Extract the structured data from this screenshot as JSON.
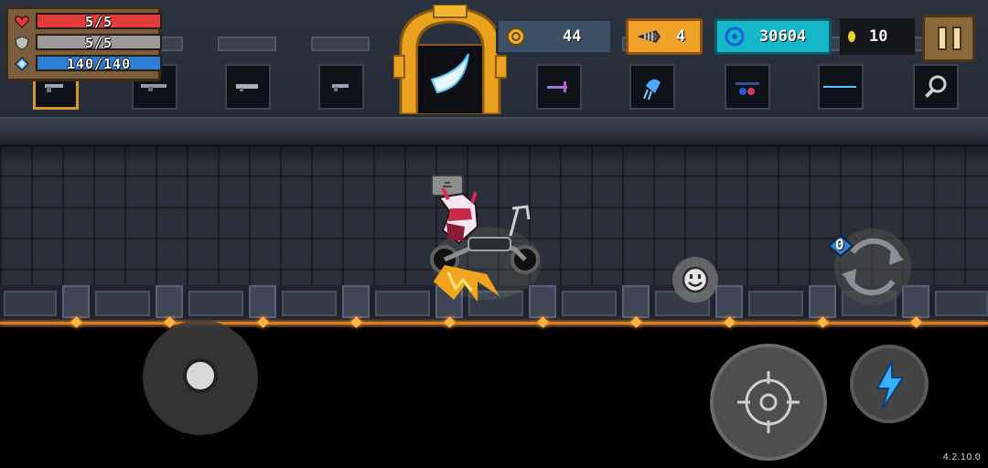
{
  "hud": {
    "health": {
      "text": "5/5",
      "fraction": 1.0,
      "color": "#e03c3c"
    },
    "armor": {
      "text": "5/5",
      "fraction": 1.0,
      "color": "#9a9a9a"
    },
    "energy": {
      "text": "140/140",
      "fraction": 1.0,
      "color": "#2d7fd6"
    }
  },
  "currency": {
    "coins": "44",
    "materials": "4",
    "gems": "30604",
    "seeds": "10"
  },
  "weapon_slots": [
    {
      "name": "pistol",
      "selected": true
    },
    {
      "name": "rifle",
      "selected": false
    },
    {
      "name": "smg",
      "selected": false
    },
    {
      "name": "handgun",
      "selected": false
    },
    {
      "name": "portal-blade",
      "selected": false
    },
    {
      "name": "purple-crossbow",
      "selected": false
    },
    {
      "name": "blue-jellyfish-staff",
      "selected": false
    },
    {
      "name": "blue-sniper",
      "selected": false
    },
    {
      "name": "laser-sword",
      "selected": false
    },
    {
      "name": "magnifier",
      "selected": false
    }
  ],
  "weapon": {
    "ammo": "0"
  },
  "icons": {
    "health": "heart-icon",
    "armor": "shield-icon",
    "energy": "energy-crystal-icon",
    "coins": "coin-icon",
    "materials": "fish-bone-icon",
    "gems": "gem-icon",
    "seeds": "seed-icon",
    "pause": "pause-icon",
    "emote": "smiley-icon",
    "swap": "swap-weapon-icon",
    "fire": "crosshair-icon",
    "skill": "lightning-icon"
  },
  "version": "4.2.10.0"
}
